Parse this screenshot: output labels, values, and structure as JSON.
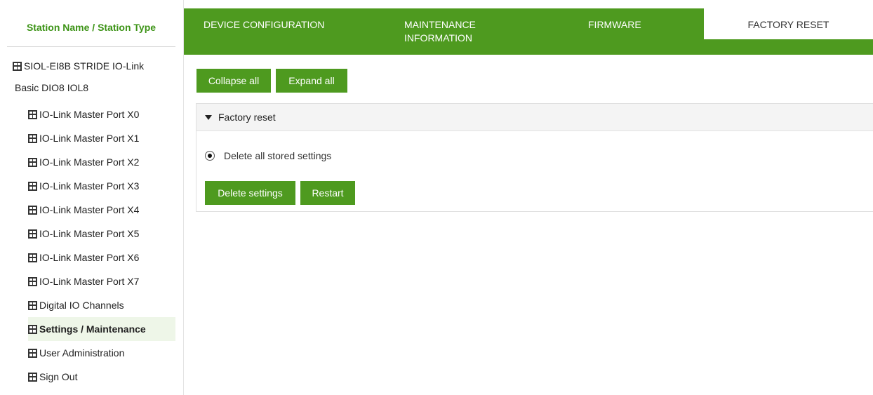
{
  "sidebar": {
    "header": "Station Name / Station Type",
    "root": {
      "line1": "SIOL-EI8B STRIDE IO-Link",
      "line2": "Basic DIO8 IOL8"
    },
    "items": [
      {
        "label": "IO-Link Master Port X0",
        "active": false
      },
      {
        "label": "IO-Link Master Port X1",
        "active": false
      },
      {
        "label": "IO-Link Master Port X2",
        "active": false
      },
      {
        "label": "IO-Link Master Port X3",
        "active": false
      },
      {
        "label": "IO-Link Master Port X4",
        "active": false
      },
      {
        "label": "IO-Link Master Port X5",
        "active": false
      },
      {
        "label": "IO-Link Master Port X6",
        "active": false
      },
      {
        "label": "IO-Link Master Port X7",
        "active": false
      },
      {
        "label": "Digital IO Channels",
        "active": false
      },
      {
        "label": "Settings / Maintenance",
        "active": true
      },
      {
        "label": "User Administration",
        "active": false
      },
      {
        "label": "Sign Out",
        "active": false
      }
    ],
    "icon": "station-node-icon"
  },
  "tabs": [
    {
      "label": "DEVICE CONFIGURATION"
    },
    {
      "label": "MAINTENANCE INFORMATION"
    },
    {
      "label": "FIRMWARE"
    },
    {
      "label": "FACTORY RESET",
      "active": true
    }
  ],
  "toolbar": {
    "collapse_label": "Collapse all",
    "expand_label": "Expand all"
  },
  "panel": {
    "title": "Factory reset",
    "radio_label": "Delete all stored settings",
    "radio_selected": true,
    "delete_label": "Delete settings",
    "restart_label": "Restart"
  },
  "colors": {
    "accent_green": "#4e9a1f",
    "header_green_text": "#3e9418",
    "active_item_bg": "#eef6e8"
  }
}
